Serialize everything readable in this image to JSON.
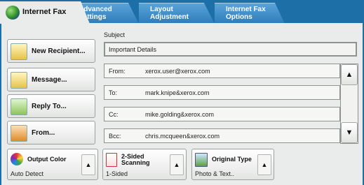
{
  "tabs": {
    "active": "Internet Fax",
    "advanced_line1": "Advanced",
    "advanced_line2": "Settings",
    "layout_line1": "Layout",
    "layout_line2": "Adjustment",
    "options_line1": "Internet Fax",
    "options_line2": "Options"
  },
  "left_buttons": {
    "new_recipient": "New Recipient...",
    "message": "Message...",
    "reply_to": "Reply To...",
    "from": "From..."
  },
  "subject": {
    "label": "Subject",
    "value": "Important Details"
  },
  "address_fields": [
    {
      "label": "From:",
      "value": "xerox.user@xerox.com"
    },
    {
      "label": "To:",
      "value": "mark.knipe&xerox.com"
    },
    {
      "label": "Cc:",
      "value": "mike.golding&xerox.com"
    },
    {
      "label": "Bcc:",
      "value": "chris.mcqueen&xerox.com"
    }
  ],
  "scroll": {
    "up": "▲",
    "down": "▼"
  },
  "bottom_buttons": {
    "output_color": {
      "title": "Output Color",
      "value": "Auto Detect"
    },
    "two_sided": {
      "title_line1": "2-Sided",
      "title_line2": "Scanning",
      "value": "1-Sided"
    },
    "original_type": {
      "title": "Original Type",
      "value": "Photo & Text.."
    },
    "caret": "▲"
  },
  "colors": {
    "tab_bar": "#1d6fa8",
    "panel": "#e9ecea"
  },
  "icons": {
    "tab": "globe-icon",
    "new_recipient": "envelope-add-icon",
    "message": "message-icon",
    "reply_to": "reply-icon",
    "from": "from-icon",
    "output_color": "color-wheel-icon",
    "two_sided": "two-sided-page-icon",
    "original_type": "photo-icon"
  }
}
